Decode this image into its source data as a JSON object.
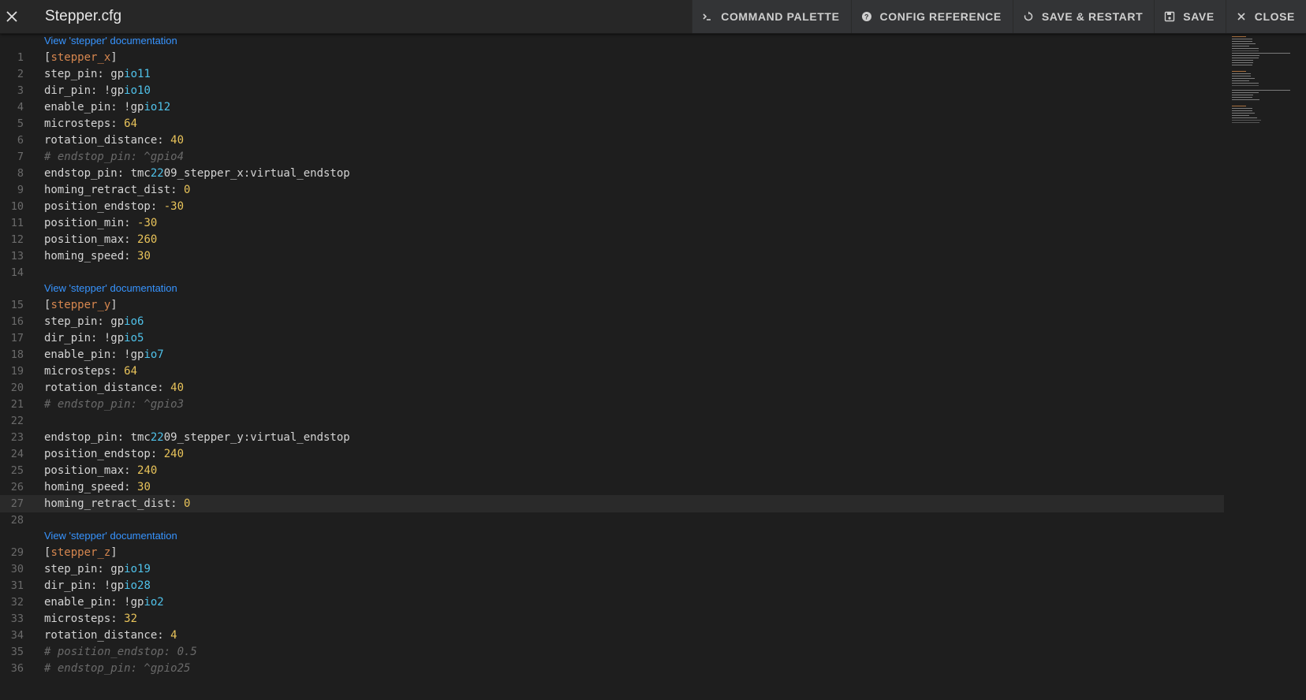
{
  "header": {
    "title": "Stepper.cfg",
    "actions": [
      {
        "label": "COMMAND PALETTE",
        "icon": "terminal-icon"
      },
      {
        "label": "CONFIG REFERENCE",
        "icon": "help-circle-icon"
      },
      {
        "label": "SAVE & RESTART",
        "icon": "restart-icon"
      },
      {
        "label": "SAVE",
        "icon": "floppy-disk-icon"
      },
      {
        "label": "CLOSE",
        "icon": "close-icon"
      }
    ]
  },
  "editor": {
    "active_line": 27,
    "code_lens": [
      {
        "before_line": 1,
        "label": "View 'stepper' documentation"
      },
      {
        "before_line": 15,
        "label": "View 'stepper' documentation"
      },
      {
        "before_line": 29,
        "label": "View 'stepper' documentation"
      }
    ],
    "lines": [
      {
        "n": "1",
        "text": "[stepper_x]"
      },
      {
        "n": "2",
        "text": "step_pin: gpio11"
      },
      {
        "n": "3",
        "text": "dir_pin: !gpio10"
      },
      {
        "n": "4",
        "text": "enable_pin: !gpio12"
      },
      {
        "n": "5",
        "text": "microsteps: 64"
      },
      {
        "n": "6",
        "text": "rotation_distance: 40"
      },
      {
        "n": "7",
        "text": "# endstop_pin: ^gpio4"
      },
      {
        "n": "8",
        "text": "endstop_pin: tmc2209_stepper_x:virtual_endstop"
      },
      {
        "n": "9",
        "text": "homing_retract_dist: 0"
      },
      {
        "n": "10",
        "text": "position_endstop: -30"
      },
      {
        "n": "11",
        "text": "position_min: -30"
      },
      {
        "n": "12",
        "text": "position_max: 260"
      },
      {
        "n": "13",
        "text": "homing_speed: 30"
      },
      {
        "n": "14",
        "text": ""
      },
      {
        "n": "15",
        "text": "[stepper_y]"
      },
      {
        "n": "16",
        "text": "step_pin: gpio6"
      },
      {
        "n": "17",
        "text": "dir_pin: !gpio5"
      },
      {
        "n": "18",
        "text": "enable_pin: !gpio7"
      },
      {
        "n": "19",
        "text": "microsteps: 64"
      },
      {
        "n": "20",
        "text": "rotation_distance: 40"
      },
      {
        "n": "21",
        "text": "# endstop_pin: ^gpio3"
      },
      {
        "n": "22",
        "text": ""
      },
      {
        "n": "23",
        "text": "endstop_pin: tmc2209_stepper_y:virtual_endstop"
      },
      {
        "n": "24",
        "text": "position_endstop: 240"
      },
      {
        "n": "25",
        "text": "position_max: 240"
      },
      {
        "n": "26",
        "text": "homing_speed: 30"
      },
      {
        "n": "27",
        "text": "homing_retract_dist: 0"
      },
      {
        "n": "28",
        "text": ""
      },
      {
        "n": "29",
        "text": "[stepper_z]"
      },
      {
        "n": "30",
        "text": "step_pin: gpio19"
      },
      {
        "n": "31",
        "text": "dir_pin: !gpio28"
      },
      {
        "n": "32",
        "text": "enable_pin: !gpio2"
      },
      {
        "n": "33",
        "text": "microsteps: 32"
      },
      {
        "n": "34",
        "text": "rotation_distance: 4"
      },
      {
        "n": "35",
        "text": "# position_endstop: 0.5"
      },
      {
        "n": "36",
        "text": "# endstop_pin: ^gpio25"
      }
    ]
  },
  "colors": {
    "section": "#d7874f",
    "number": "#e8c35a",
    "pin": "#4fc1e9",
    "comment": "#6a6a6a",
    "link": "#3794ff"
  }
}
